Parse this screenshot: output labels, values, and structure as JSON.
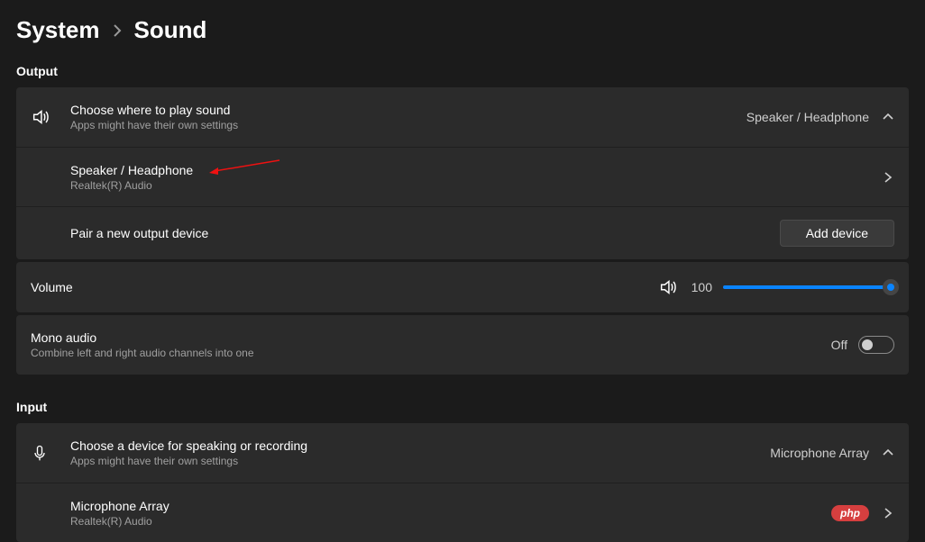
{
  "breadcrumb": {
    "parent": "System",
    "current": "Sound"
  },
  "output": {
    "section_label": "Output",
    "choose": {
      "title": "Choose where to play sound",
      "sub": "Apps might have their own settings",
      "current": "Speaker / Headphone"
    },
    "device": {
      "title": "Speaker / Headphone",
      "sub": "Realtek(R) Audio"
    },
    "pair": {
      "title": "Pair a new output device",
      "button": "Add device"
    },
    "volume": {
      "title": "Volume",
      "value": "100"
    },
    "mono": {
      "title": "Mono audio",
      "sub": "Combine left and right audio channels into one",
      "state": "Off"
    }
  },
  "input": {
    "section_label": "Input",
    "choose": {
      "title": "Choose a device for speaking or recording",
      "sub": "Apps might have their own settings",
      "current": "Microphone Array"
    },
    "device": {
      "title": "Microphone Array",
      "sub": "Realtek(R) Audio"
    }
  },
  "badge": {
    "php": "php"
  }
}
